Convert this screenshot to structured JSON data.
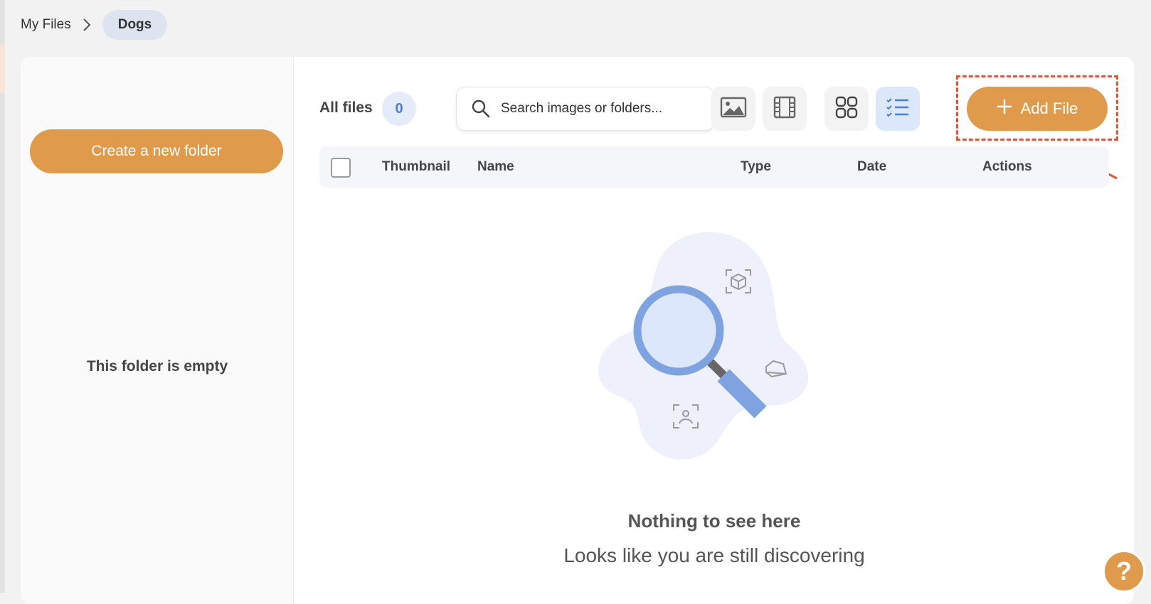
{
  "breadcrumb": {
    "root": "My Files",
    "current": "Dogs"
  },
  "sidebar": {
    "create_folder_label": "Create a new folder",
    "empty_text": "This folder is empty"
  },
  "toolbar": {
    "all_files_label": "All files",
    "file_count": "0",
    "search_placeholder": "Search images or folders...",
    "add_file_label": "Add File",
    "icons": [
      "image-filter-icon",
      "video-filter-icon",
      "grid-view-icon",
      "list-view-icon"
    ]
  },
  "table": {
    "columns": [
      "Thumbnail",
      "Name",
      "Type",
      "Date",
      "Actions"
    ]
  },
  "empty_state": {
    "title": "Nothing to see here",
    "subtitle": "Looks like you are still discovering"
  },
  "help": {
    "label": "?"
  },
  "colors": {
    "accent": "#e09a4c",
    "highlight": "#e0533a",
    "active": "#4a7fd6"
  }
}
